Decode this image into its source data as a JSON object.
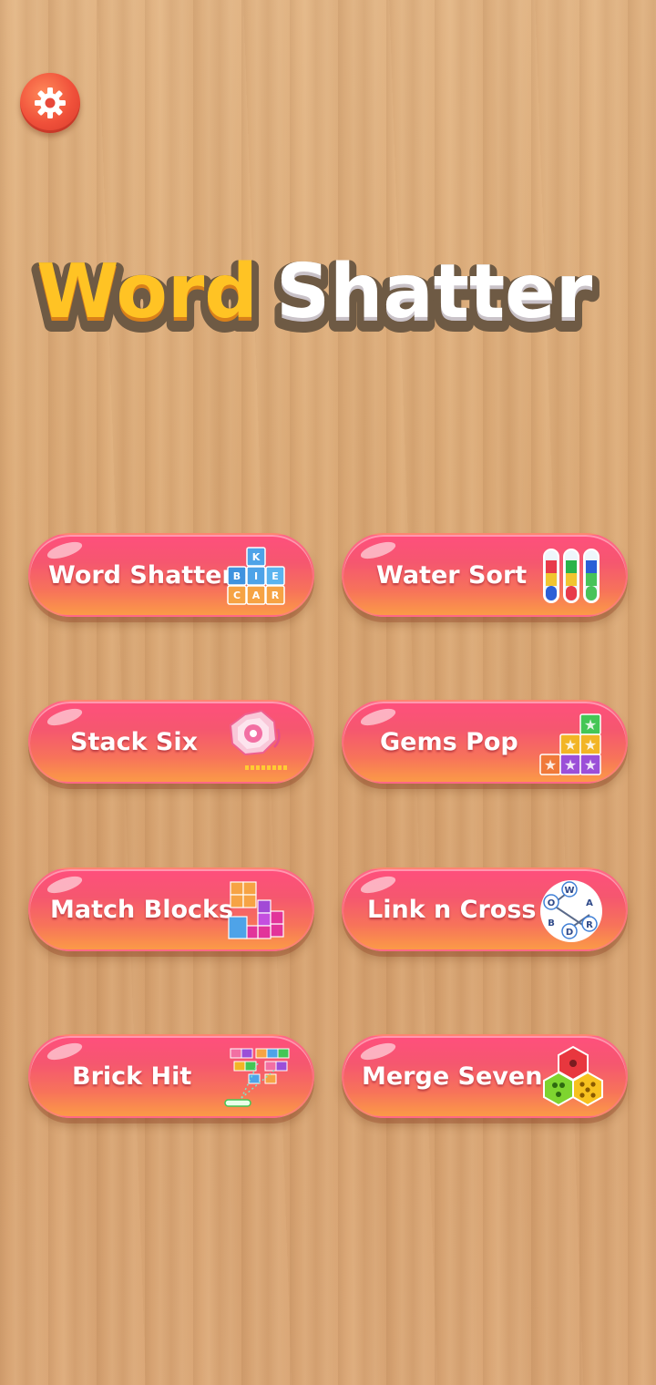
{
  "header": {
    "title_part1": "Word",
    "title_part2": "Shatter",
    "settings_icon": "gear-icon"
  },
  "colors": {
    "button_top": "#ff4f7d",
    "button_bottom": "#fb9a47",
    "title_yellow": "#ffc324",
    "title_white": "#ffffff",
    "settings_red": "#f0503a"
  },
  "games": [
    {
      "label": "Word Shatter",
      "icon": "letter-blocks-icon",
      "letters": [
        "K",
        "B",
        "I",
        "E",
        "C",
        "A",
        "R"
      ]
    },
    {
      "label": "Water Sort",
      "icon": "test-tubes-icon"
    },
    {
      "label": "Stack Six",
      "icon": "hexagon-stack-icon"
    },
    {
      "label": "Gems Pop",
      "icon": "star-gems-icon"
    },
    {
      "label": "Match Blocks",
      "icon": "tetris-blocks-icon"
    },
    {
      "label": "Link n Cross",
      "icon": "letter-wheel-icon",
      "letters": [
        "W",
        "O",
        "A",
        "B",
        "D",
        "R"
      ]
    },
    {
      "label": "Brick Hit",
      "icon": "brick-breaker-icon"
    },
    {
      "label": "Merge Seven",
      "icon": "hex-dice-icon"
    }
  ]
}
